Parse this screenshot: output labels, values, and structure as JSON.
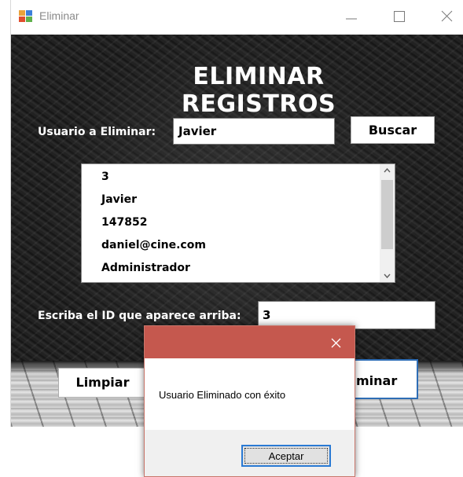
{
  "window": {
    "title": "Eliminar",
    "controls": {
      "minimize_icon": "minimize-icon",
      "maximize_icon": "maximize-icon",
      "close_icon": "close-icon"
    }
  },
  "form": {
    "heading": "ELIMINAR REGISTROS",
    "user_label": "Usuario a Eliminar:",
    "user_value": "Javier",
    "search_button": "Buscar",
    "list_items": [
      "3",
      "Javier",
      "147852",
      "daniel@cine.com",
      "Administrador"
    ],
    "id_label": "Escriba el ID que aparece arriba:",
    "id_value": "3",
    "clear_button": "Limpiar",
    "delete_button": "Eliminar",
    "delete_button_visible": "liminar"
  },
  "dialog": {
    "title": "",
    "message": "Usuario Eliminado con éxito",
    "ok_button": "Aceptar",
    "close_icon": "close-icon"
  },
  "colors": {
    "dialog_titlebar": "#c5584e",
    "focus_border": "#2a7ad4"
  }
}
